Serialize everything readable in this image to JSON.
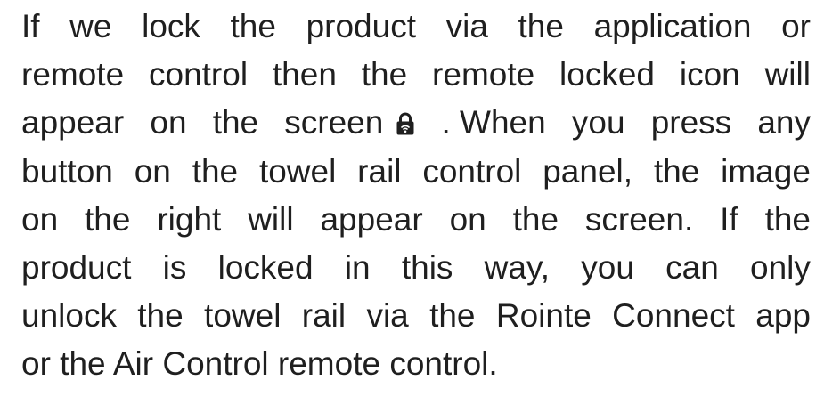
{
  "paragraph": {
    "lines": [
      [
        "If",
        "we",
        "lock",
        "the",
        "product",
        "via",
        "the",
        "application",
        "or"
      ],
      [
        "remote",
        "control",
        "then",
        "the",
        "remote",
        "locked",
        "icon",
        "will"
      ],
      [
        "appear",
        "on",
        "the",
        "screen"
      ],
      [
        ". When",
        "you",
        "press",
        "any"
      ],
      [
        "button",
        "on",
        "the",
        "towel",
        "rail",
        "control",
        "panel,",
        "the",
        "image"
      ],
      [
        "on",
        "the",
        "right",
        "will",
        "appear",
        "on",
        "the",
        "screen.",
        "If",
        "the"
      ],
      [
        "product",
        "is",
        "locked",
        "in",
        "this",
        "way,",
        "you",
        "can",
        "only"
      ],
      [
        "unlock",
        "the",
        "towel",
        "rail",
        "via",
        "the",
        "Rointe",
        "Connect",
        "app"
      ],
      "or the Air Control remote control."
    ],
    "icon": "remote-lock-icon"
  }
}
